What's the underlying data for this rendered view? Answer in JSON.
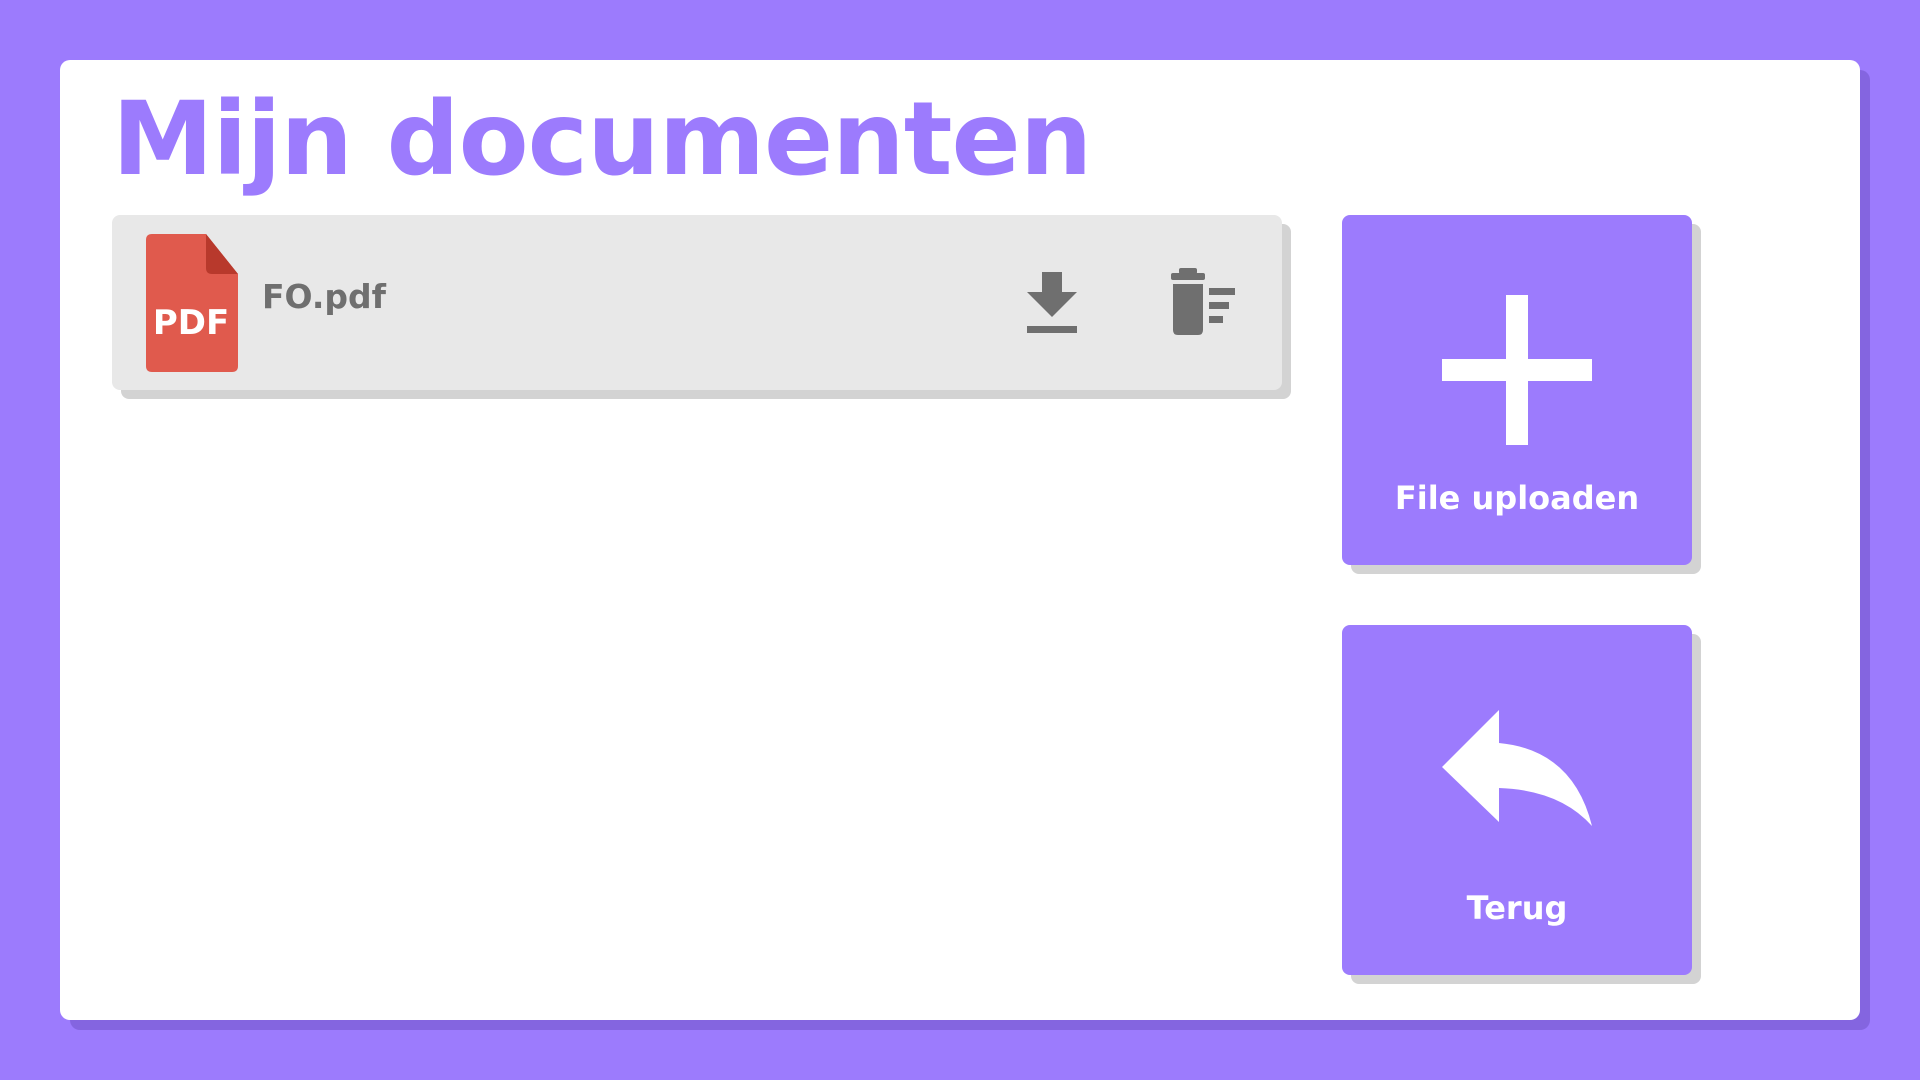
{
  "header": {
    "title": "Mijn documenten"
  },
  "files": [
    {
      "name": "FO.pdf",
      "type_badge": "PDF",
      "icon": "pdf-file-icon",
      "actions": [
        "download-icon",
        "delete-icon"
      ]
    }
  ],
  "actions": {
    "upload": {
      "label": "File uploaden",
      "icon": "plus-icon"
    },
    "back": {
      "label": "Terug",
      "icon": "reply-arrow-icon"
    }
  },
  "colors": {
    "background": "#9c7bfd",
    "accent": "#9c7bfd",
    "panel": "#ffffff",
    "row": "#e8e8e8",
    "icon_gray": "#6f6f6f",
    "pdf_red": "#e05a4d"
  }
}
